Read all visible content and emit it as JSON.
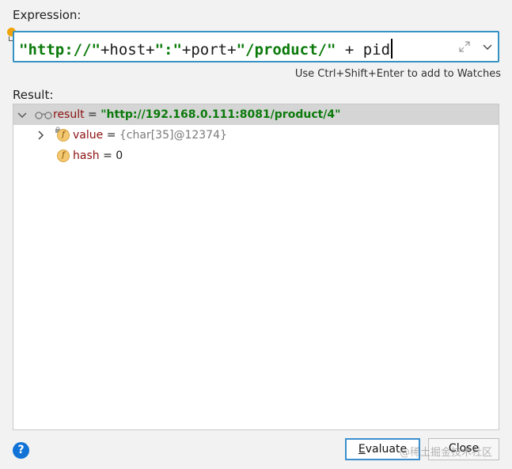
{
  "expression": {
    "label": "Expression:",
    "tokens": [
      {
        "text": "\"http://\"",
        "kind": "string"
      },
      {
        "text": "+host+",
        "kind": "plain"
      },
      {
        "text": "\":\"",
        "kind": "string"
      },
      {
        "text": "+port+",
        "kind": "plain"
      },
      {
        "text": "\"/product/\"",
        "kind": "string"
      },
      {
        "text": " + pid",
        "kind": "plain"
      }
    ],
    "hint": "Use Ctrl+Shift+Enter to add to Watches"
  },
  "result": {
    "label": "Result:",
    "root": {
      "name": "result",
      "eq": " = ",
      "value": "\"http://192.168.0.111:8081/product/4\""
    },
    "children": [
      {
        "icon_letter": "f",
        "name": "value",
        "eq": " = ",
        "value": "{char[35]@12374}",
        "expandable": true
      },
      {
        "icon_letter": "f",
        "name": "hash",
        "eq": " = ",
        "value": "0",
        "expandable": false
      }
    ]
  },
  "footer": {
    "help_symbol": "?",
    "evaluate_mnemonic": "E",
    "evaluate_rest": "valuate",
    "close_label": "Close",
    "watermark": "@稀土掘金技术社区"
  },
  "colors": {
    "accent_border": "#3592c4",
    "string": "#0b7a0b",
    "var_name": "#8b0f0f",
    "help_blue": "#1273d6",
    "selected_row": "#d5d5d5"
  }
}
